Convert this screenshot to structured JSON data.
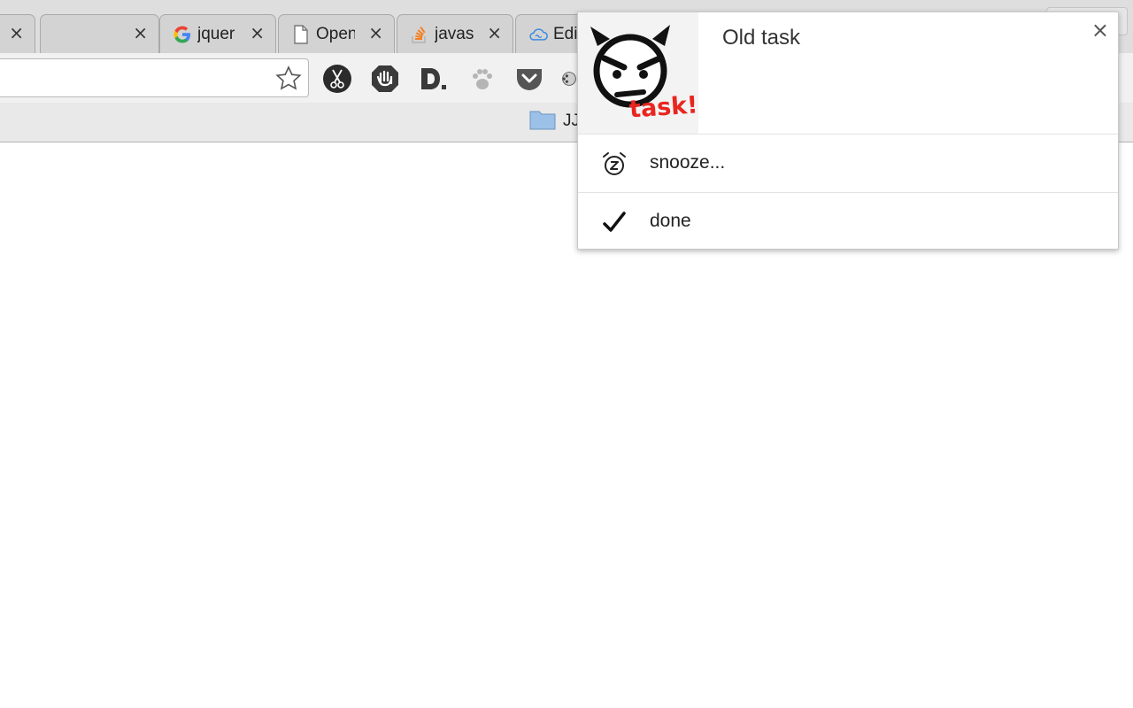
{
  "browser": {
    "tabs": [
      {
        "title": "",
        "close": "×"
      },
      {
        "title": "",
        "close": "×"
      },
      {
        "title": "jquer",
        "close": "×",
        "icon": "google-icon"
      },
      {
        "title": "Open",
        "close": "×",
        "icon": "document-icon"
      },
      {
        "title": "javas",
        "close": "×",
        "icon": "stackoverflow-icon"
      },
      {
        "title": "Edi",
        "close": "×",
        "icon": "cloud-icon"
      }
    ],
    "bookmark_folder": "JJ"
  },
  "notification": {
    "title": "Old task",
    "close": "×",
    "icon_text": "task!",
    "actions": [
      {
        "label": "snooze...",
        "icon": "alarm-clock-icon"
      },
      {
        "label": "done",
        "icon": "checkmark-icon"
      }
    ]
  },
  "colors": {
    "accent_red": "#e8261f",
    "chrome_bg": "#e8e8e8"
  }
}
